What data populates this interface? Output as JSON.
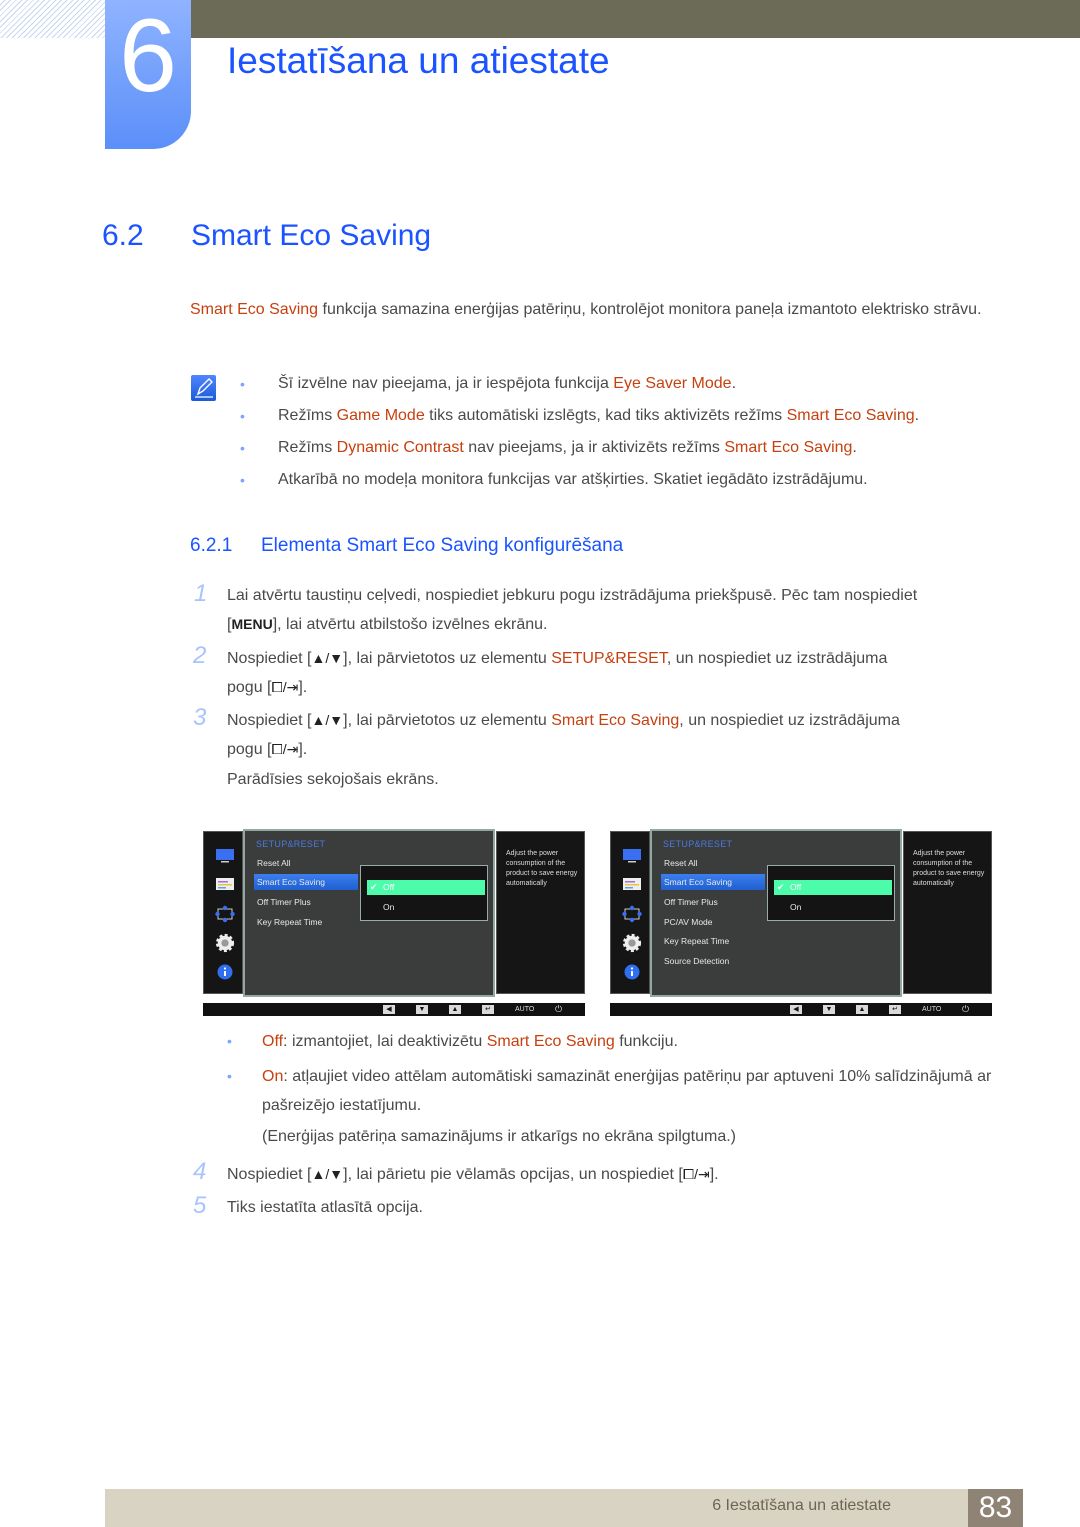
{
  "chapter": {
    "number": "6",
    "title": "Iestatīšana un atiestate"
  },
  "section": {
    "number": "6.2",
    "title": "Smart Eco Saving"
  },
  "intro": {
    "highlight": "Smart Eco Saving",
    "text": " funkcija samazina enerģijas patēriņu, kontrolējot monitora paneļa izmantoto elektrisko strāvu."
  },
  "notes": [
    {
      "pre": "Šī izvēlne nav pieejama, ja ir iespējota funkcija ",
      "hl1": "Eye Saver Mode",
      "mid": ".",
      "hl2": "",
      "post": ""
    },
    {
      "pre": "Režīms ",
      "hl1": "Game Mode",
      "mid": " tiks automātiski izslēgts, kad tiks aktivizēts režīms ",
      "hl2": "Smart Eco Saving",
      "post": "."
    },
    {
      "pre": "Režīms ",
      "hl1": "Dynamic Contrast",
      "mid": " nav pieejams, ja ir aktivizēts režīms ",
      "hl2": "Smart Eco Saving",
      "post": "."
    },
    {
      "pre": "Atkarībā no modeļa monitora funkcijas var atšķirties. Skatiet iegādāto izstrādājumu.",
      "hl1": "",
      "mid": "",
      "hl2": "",
      "post": ""
    }
  ],
  "subsection": {
    "number": "6.2.1",
    "title": "Elementa Smart Eco Saving konfigurēšana"
  },
  "steps": [
    {
      "num": "1",
      "line1": "Lai atvērtu taustiņu ceļvedi, nospiediet jebkuru pogu izstrādājuma priekšpusē. Pēc tam nospiediet",
      "key": "MENU",
      "line2": ", lai atvērtu atbilstošo izvēlnes ekrānu."
    },
    {
      "num": "2",
      "pre": "Nospiediet ",
      "keys": "▲/▼",
      "mid": ", lai pārvietotos uz elementu ",
      "hl": "SETUP&RESET",
      "post": ", un nospiediet uz izstrādājuma",
      "line2pre": "pogu ",
      "line2post": "."
    },
    {
      "num": "3",
      "pre": "Nospiediet ",
      "keys": "▲/▼",
      "mid": ", lai pārvietotos uz elementu ",
      "hl": "Smart Eco Saving",
      "post": ", un nospiediet uz izstrādājuma",
      "line2pre": "pogu ",
      "line2post": ".",
      "after": "Parādīsies sekojošais ekrāns."
    },
    {
      "num": "4",
      "pre": "Nospiediet ",
      "keys": "▲/▼",
      "mid": ", lai pārietu pie vēlamās opcijas, un nospiediet ",
      "post": "."
    },
    {
      "num": "5",
      "text": "Tiks iestatīta atlasītā opcija."
    }
  ],
  "osd_screens": [
    {
      "header": "SETUP&RESET",
      "items": [
        "Reset All",
        "Smart Eco Saving",
        "Off Timer Plus",
        "Key Repeat Time"
      ],
      "selected_index": 1,
      "options": [
        "Off",
        "On"
      ],
      "selected_option": "Off",
      "description": "Adjust the power consumption of the product to save energy automatically",
      "bar_auto": "AUTO"
    },
    {
      "header": "SETUP&RESET",
      "items": [
        "Reset All",
        "Smart Eco Saving",
        "Off Timer Plus",
        "PC/AV Mode",
        "Key Repeat Time",
        "Source Detection"
      ],
      "selected_index": 1,
      "options": [
        "Off",
        "On"
      ],
      "selected_option": "Off",
      "description": "Adjust the power consumption of the product to save energy automatically",
      "bar_auto": "AUTO"
    }
  ],
  "options_explained": [
    {
      "label": "Off",
      "pre": ": izmantojiet, lai deaktivizētu ",
      "hl": "Smart Eco Saving",
      "post": " funkciju."
    },
    {
      "label": "On",
      "text": ": atļaujiet video attēlam automātiski samazināt enerģijas patēriņu par aptuveni 10% salīdzinājumā ar pašreizējo iestatījumu.",
      "note": "(Enerģijas patēriņa samazinājums ir atkarīgs no ekrāna spilgtuma.)"
    }
  ],
  "footer": {
    "text": "6 Iestatīšana un atiestate",
    "page": "83"
  },
  "colors": {
    "heading_blue": "#1a53ff",
    "highlight_orange": "#c7400f",
    "osd_selected": "#4dfcaa"
  }
}
